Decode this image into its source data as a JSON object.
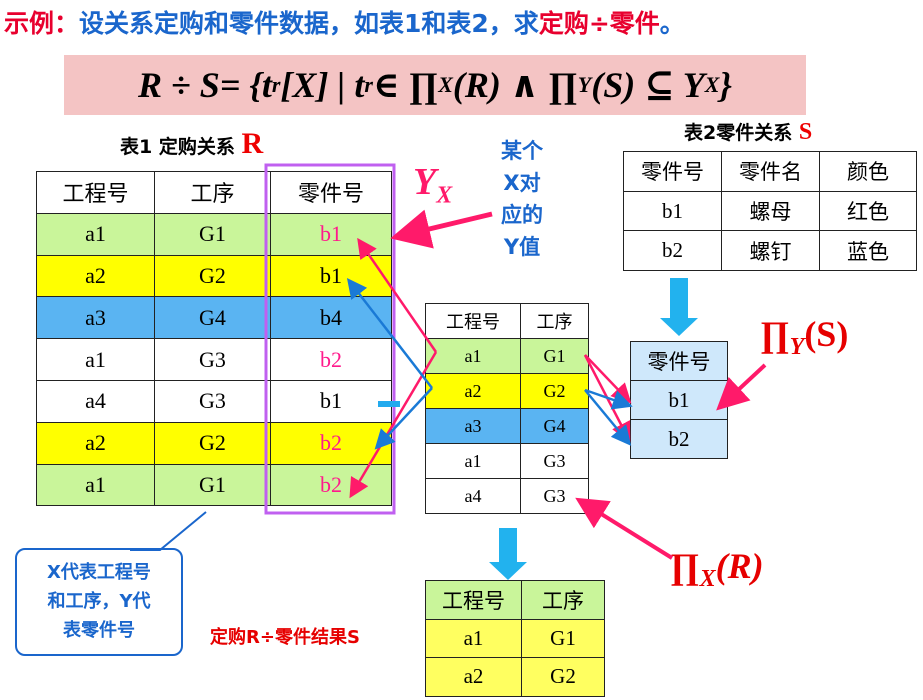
{
  "title": {
    "p1": "示例：",
    "p2": "设关系定购和零件数据，如表1和表2，求",
    "p3": "定购÷零件",
    "p4": "。"
  },
  "formula": {
    "lhs": "R ÷ S",
    "rhs": " = {t",
    "sub_r": "r",
    "rest1": " [X] | t",
    "sub_r2": "r",
    "rest2": " ∈ ∏",
    "sub_x": "X",
    "rest3": " (R) ∧ ∏",
    "sub_y": "Y",
    "rest4": " (S) ⊆ Y",
    "sub_x2": "X",
    "rest5": " }"
  },
  "table1": {
    "caption": "表1 定购关系",
    "caption_letter": "R",
    "headers": [
      "工程号",
      "工序",
      "零件号"
    ],
    "rows": [
      [
        "a1",
        "G1",
        "b1"
      ],
      [
        "a2",
        "G2",
        "b1"
      ],
      [
        "a3",
        "G4",
        "b4"
      ],
      [
        "a1",
        "G3",
        "b2"
      ],
      [
        "a4",
        "G3",
        "b1"
      ],
      [
        "a2",
        "G2",
        "b2"
      ],
      [
        "a1",
        "G1",
        "b2"
      ]
    ]
  },
  "table2": {
    "caption": "表2零件关系",
    "caption_letter": "S",
    "headers": [
      "零件号",
      "零件名",
      "颜色"
    ],
    "rows": [
      [
        "b1",
        "螺母",
        "红色"
      ],
      [
        "b2",
        "螺钉",
        "蓝色"
      ]
    ]
  },
  "projection_x": {
    "headers": [
      "工程号",
      "工序"
    ],
    "rows": [
      [
        "a1",
        "G1"
      ],
      [
        "a2",
        "G2"
      ],
      [
        "a3",
        "G4"
      ],
      [
        "a1",
        "G3"
      ],
      [
        "a4",
        "G3"
      ]
    ]
  },
  "projection_y": {
    "headers": [
      "零件号"
    ],
    "rows": [
      [
        "b1"
      ],
      [
        "b2"
      ]
    ]
  },
  "result": {
    "label": "定购R÷零件结果S",
    "headers": [
      "工程号",
      "工序"
    ],
    "rows": [
      [
        "a1",
        "G1"
      ],
      [
        "a2",
        "G2"
      ]
    ]
  },
  "labels": {
    "yx_main": "Y",
    "yx_sub": "X",
    "some_x": [
      "某个",
      "X对",
      "应的",
      "Y值"
    ],
    "note": [
      "X代表工程号",
      "和工序，Y代",
      "表零件号"
    ],
    "piy_main": "∏",
    "piy_sub": "Y",
    "piy_arg": "(S)",
    "pix_main": "∏",
    "pix_sub": "X",
    "pix_arg": "(R)"
  },
  "colors": {
    "green": "#c9f59a",
    "yellow": "#ffff00",
    "blue": "#5ab4f2",
    "pink_arrow": "#ff1a6a",
    "blue_arrow": "#1a7ad6",
    "red_text": "#e00000"
  }
}
